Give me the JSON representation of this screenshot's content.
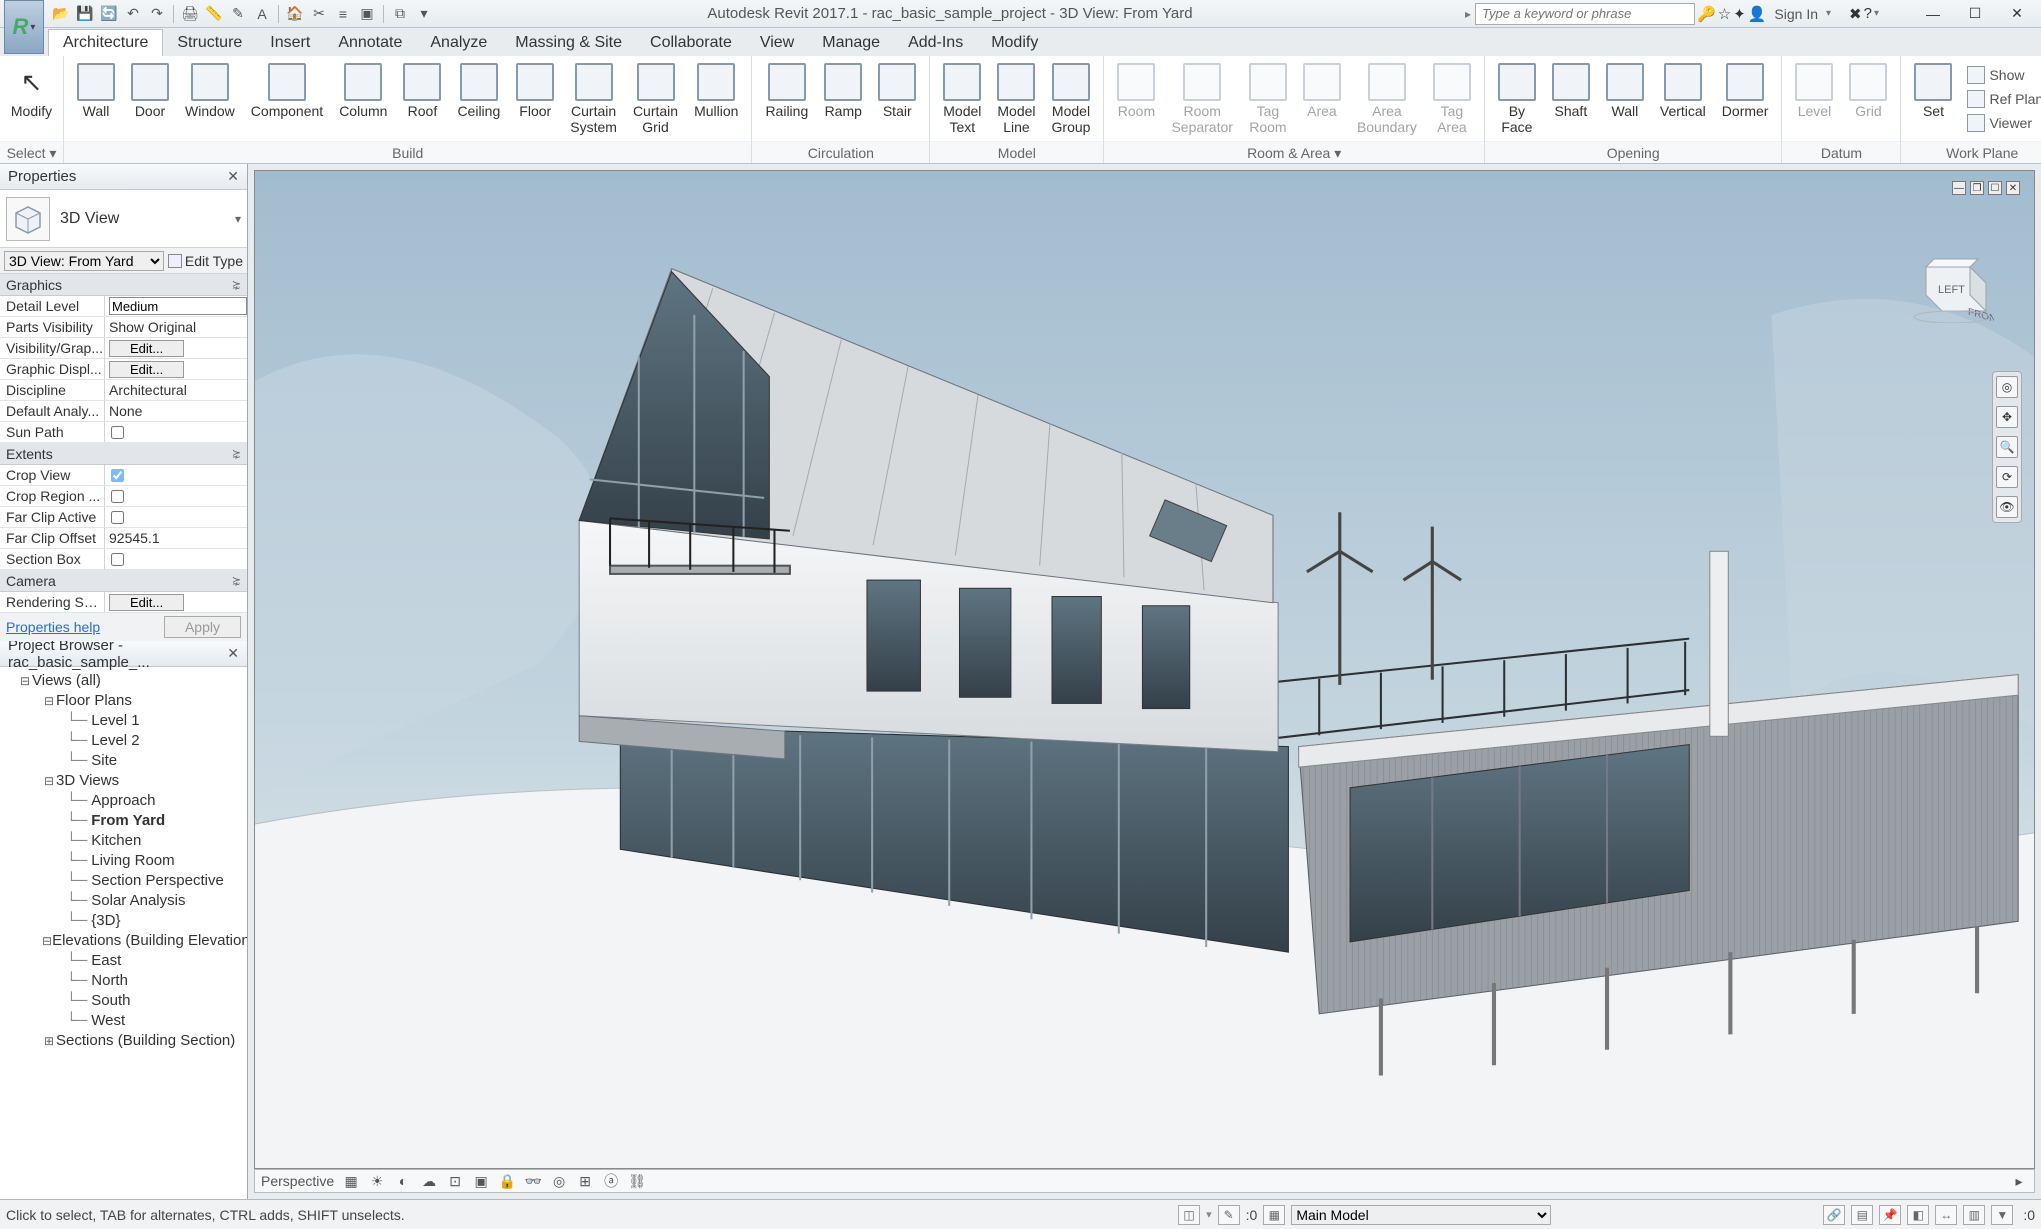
{
  "app": {
    "title": "Autodesk Revit 2017.1 -    rac_basic_sample_project - 3D View: From Yard",
    "search_placeholder": "Type a keyword or phrase",
    "signin": "Sign In"
  },
  "qat": [
    "open",
    "save",
    "sync",
    "undo",
    "redo",
    "print",
    "measure",
    "text",
    "3d",
    "section",
    "thin",
    "close",
    "switch",
    "browser"
  ],
  "tabs": [
    "Architecture",
    "Structure",
    "Insert",
    "Annotate",
    "Analyze",
    "Massing & Site",
    "Collaborate",
    "View",
    "Manage",
    "Add-Ins",
    "Modify"
  ],
  "active_tab": "Architecture",
  "ribbon": {
    "select_panel": {
      "modify": "Modify",
      "title": "Select ▾"
    },
    "build": {
      "title": "Build",
      "tools": [
        "Wall",
        "Door",
        "Window",
        "Component",
        "Column",
        "Roof",
        "Ceiling",
        "Floor",
        "Curtain\nSystem",
        "Curtain\nGrid",
        "Mullion"
      ]
    },
    "circulation": {
      "title": "Circulation",
      "tools": [
        "Railing",
        "Ramp",
        "Stair"
      ]
    },
    "model": {
      "title": "Model",
      "tools": [
        "Model\nText",
        "Model\nLine",
        "Model\nGroup"
      ]
    },
    "room_area": {
      "title": "Room & Area  ▾",
      "tools": [
        "Room",
        "Room\nSeparator",
        "Tag\nRoom",
        "Area",
        "Area\nBoundary",
        "Tag\nArea"
      ]
    },
    "opening": {
      "title": "Opening",
      "tools": [
        "By\nFace",
        "Shaft",
        "Wall",
        "Vertical",
        "Dormer"
      ]
    },
    "datum": {
      "title": "Datum",
      "tools": [
        "Level",
        "Grid"
      ]
    },
    "workplane": {
      "title": "Work Plane",
      "set": "Set",
      "rows": [
        "Show",
        "Ref Plane",
        "Viewer"
      ]
    }
  },
  "properties": {
    "title": "Properties",
    "type_name": "3D View",
    "instance_sel": "3D View: From Yard",
    "edit_type": "Edit Type",
    "groups": {
      "graphics": {
        "label": "Graphics",
        "rows": [
          {
            "l": "Detail Level",
            "type": "text",
            "v": "Medium"
          },
          {
            "l": "Parts Visibility",
            "type": "plain",
            "v": "Show Original"
          },
          {
            "l": "Visibility/Grap...",
            "type": "btn",
            "v": "Edit..."
          },
          {
            "l": "Graphic Displ...",
            "type": "btn",
            "v": "Edit..."
          },
          {
            "l": "Discipline",
            "type": "plain",
            "v": "Architectural"
          },
          {
            "l": "Default Analy...",
            "type": "plain",
            "v": "None"
          },
          {
            "l": "Sun Path",
            "type": "check",
            "v": false
          }
        ]
      },
      "extents": {
        "label": "Extents",
        "rows": [
          {
            "l": "Crop View",
            "type": "check",
            "v": true,
            "dim": true
          },
          {
            "l": "Crop Region ...",
            "type": "check",
            "v": false
          },
          {
            "l": "Far Clip Active",
            "type": "check",
            "v": false
          },
          {
            "l": "Far Clip Offset",
            "type": "plain",
            "v": "92545.1"
          },
          {
            "l": "Section Box",
            "type": "check",
            "v": false
          }
        ]
      },
      "camera": {
        "label": "Camera",
        "rows": [
          {
            "l": "Rendering Set...",
            "type": "btn",
            "v": "Edit..."
          }
        ]
      }
    },
    "help": "Properties help",
    "apply": "Apply"
  },
  "browser": {
    "title": "Project Browser - rac_basic_sample_...",
    "tree": [
      {
        "lvl": 0,
        "t": "Views (all)",
        "exp": "–",
        "icon": true
      },
      {
        "lvl": 1,
        "t": "Floor Plans",
        "exp": "–"
      },
      {
        "lvl": 2,
        "t": "Level 1"
      },
      {
        "lvl": 2,
        "t": "Level 2"
      },
      {
        "lvl": 2,
        "t": "Site"
      },
      {
        "lvl": 1,
        "t": "3D Views",
        "exp": "–"
      },
      {
        "lvl": 2,
        "t": "Approach"
      },
      {
        "lvl": 2,
        "t": "From Yard",
        "bold": true
      },
      {
        "lvl": 2,
        "t": "Kitchen"
      },
      {
        "lvl": 2,
        "t": "Living Room"
      },
      {
        "lvl": 2,
        "t": "Section Perspective"
      },
      {
        "lvl": 2,
        "t": "Solar Analysis"
      },
      {
        "lvl": 2,
        "t": "{3D}"
      },
      {
        "lvl": 1,
        "t": "Elevations (Building Elevation",
        "exp": "–"
      },
      {
        "lvl": 2,
        "t": "East"
      },
      {
        "lvl": 2,
        "t": "North"
      },
      {
        "lvl": 2,
        "t": "South"
      },
      {
        "lvl": 2,
        "t": "West"
      },
      {
        "lvl": 1,
        "t": "Sections (Building Section)",
        "exp": "+"
      }
    ]
  },
  "viewcube": {
    "left": "LEFT",
    "front": "FRONT"
  },
  "view_controls": {
    "mode": "Perspective"
  },
  "status": {
    "hint": "Click to select, TAB for alternates, CTRL adds, SHIFT unselects.",
    "selection_count": ":0",
    "workset": "Main Model"
  }
}
